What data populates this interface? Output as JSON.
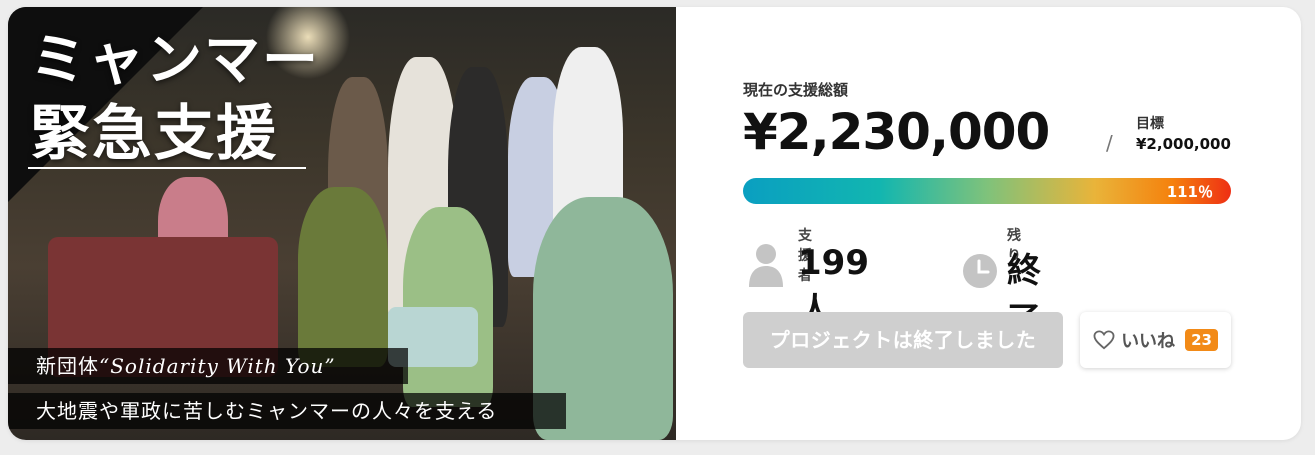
{
  "hero": {
    "title_line1": "ミャンマー",
    "title_line2": "緊急支援",
    "subtitle1_prefix": "新団体",
    "subtitle1_name": "“Solidarity With You”",
    "subtitle2": "大地震や軍政に苦しむミャンマーの人々を支える"
  },
  "funding": {
    "total_label": "現在の支援総額",
    "total_amount": "¥2,230,000",
    "separator": "/",
    "goal_label": "目標",
    "goal_amount": "¥2,000,000",
    "progress_text": "111％",
    "progress_percent": 111
  },
  "stats": {
    "backers_label": "支援者",
    "backers_value": "199人",
    "remaining_label": "残り",
    "remaining_value": "終了"
  },
  "actions": {
    "ended_label": "プロジェクトは終了しました",
    "like_label": "いいね",
    "like_count": "23"
  },
  "icons": {
    "backers": "user-icon",
    "remaining": "clock-icon",
    "like": "heart-icon"
  },
  "colors": {
    "accent_orange": "#f28a17",
    "progress_start": "#0a9fc1",
    "progress_end": "#ee2f14",
    "disabled_button": "#cfcfcf"
  }
}
